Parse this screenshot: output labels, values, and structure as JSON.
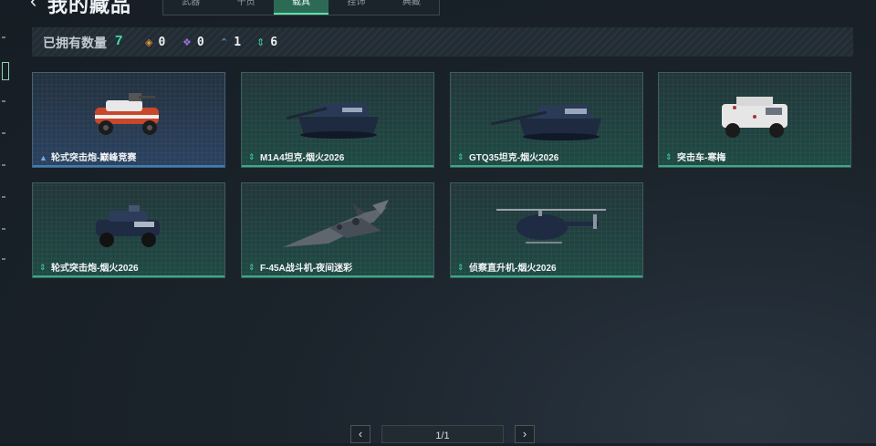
{
  "header": {
    "title": "我的藏品",
    "tabs": [
      {
        "label": "武器",
        "active": false
      },
      {
        "label": "干员",
        "active": false
      },
      {
        "label": "载具",
        "active": true
      },
      {
        "label": "挂饰",
        "active": false
      },
      {
        "label": "典藏",
        "active": false
      }
    ]
  },
  "summary": {
    "label": "已拥有数量",
    "total": "7",
    "rarities": [
      {
        "icon": "orange-diamond-icon",
        "color": "#e0913a",
        "count": "0"
      },
      {
        "icon": "purple-diamond-icon",
        "color": "#9b6fe6",
        "count": "0"
      },
      {
        "icon": "blue-chevron-icon",
        "color": "#5fa8e8",
        "count": "1"
      },
      {
        "icon": "green-chevron-icon",
        "color": "#3fd39a",
        "count": "6"
      }
    ]
  },
  "items": [
    {
      "name": "轮式突击炮-巅峰竞赛",
      "rarity": "blue"
    },
    {
      "name": "M1A4坦克-烟火2026",
      "rarity": "green"
    },
    {
      "name": "GTQ35坦克-烟火2026",
      "rarity": "green"
    },
    {
      "name": "突击车-寒梅",
      "rarity": "green"
    },
    {
      "name": "轮式突击炮-烟火2026",
      "rarity": "green"
    },
    {
      "name": "F-45A战斗机-夜间迷彩",
      "rarity": "green"
    },
    {
      "name": "侦察直升机-烟火2026",
      "rarity": "green"
    }
  ],
  "pagination": {
    "text": "1/1",
    "prev": "‹",
    "next": "›"
  }
}
